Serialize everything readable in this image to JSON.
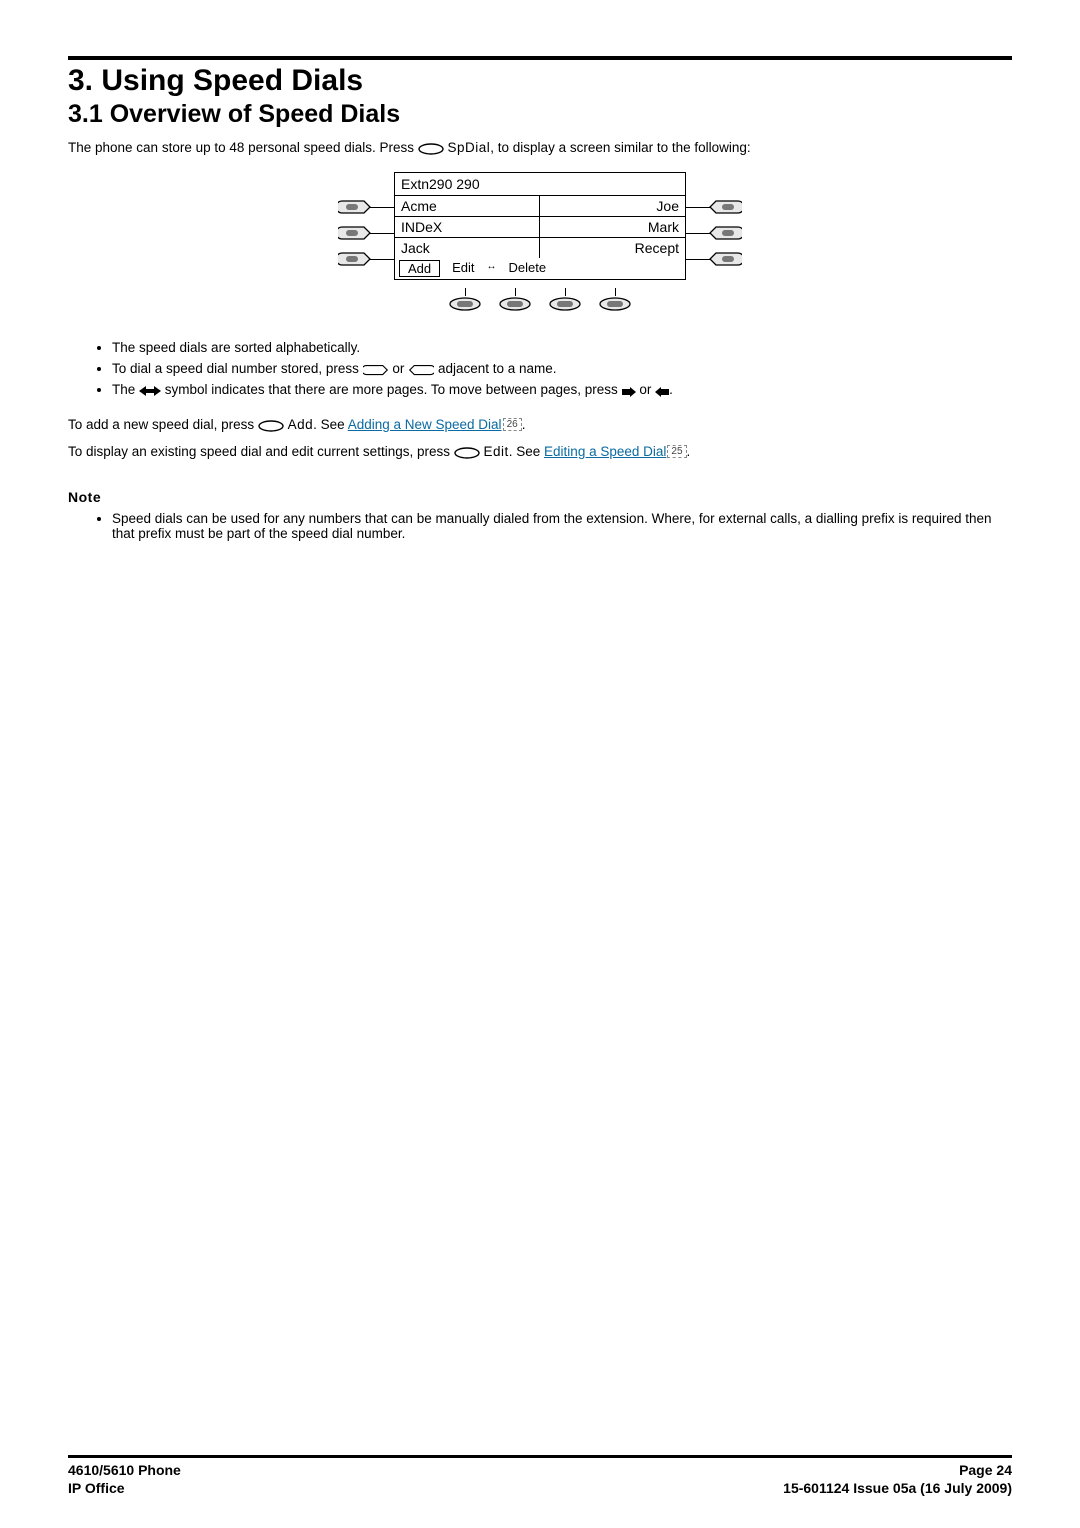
{
  "heading": {
    "h1": "3. Using Speed Dials",
    "h2": "3.1 Overview of Speed Dials"
  },
  "intro": {
    "pre": "The phone can store up to 48 personal speed dials. Press ",
    "btn": "SpDial",
    "post": ", to display a screen similar to the following:"
  },
  "phone": {
    "title": "Extn290 290",
    "rows": [
      {
        "left": "Acme",
        "right": "Joe"
      },
      {
        "left": "INDeX",
        "right": "Mark"
      },
      {
        "left": "Jack",
        "right": "Recept"
      }
    ],
    "softkeys": {
      "add": "Add",
      "edit": "Edit",
      "delete": "Delete"
    }
  },
  "bullets": {
    "b1": "The speed dials are sorted alphabetically.",
    "b2_pre": "To dial a speed dial number stored, press ",
    "b2_mid": " or ",
    "b2_post": " adjacent to a name.",
    "b3_pre": "The ",
    "b3_mid": " symbol indicates that there are more pages. To move between pages, press ",
    "b3_or": " or ",
    "b3_end": "."
  },
  "add_paragraph": {
    "pre": "To add a new speed dial, press ",
    "btn": "Add",
    "see": ". See ",
    "link": "Adding a New Speed Dial",
    "ref": "26",
    "end": "."
  },
  "edit_paragraph": {
    "pre": "To display an existing speed dial and edit current settings, press ",
    "btn": "Edit",
    "see": ". See ",
    "link": "Editing a Speed Dial",
    "ref": "25",
    "end": "."
  },
  "note": {
    "title": "Note",
    "text": "Speed dials can be used for any numbers that can be manually dialed from the extension. Where, for external calls, a dialling prefix is required then that prefix must be part of the speed dial number."
  },
  "footer": {
    "left1": "4610/5610 Phone",
    "right1": "Page 24",
    "left2": "IP Office",
    "right2": "15-601124 Issue 05a (16 July 2009)"
  }
}
